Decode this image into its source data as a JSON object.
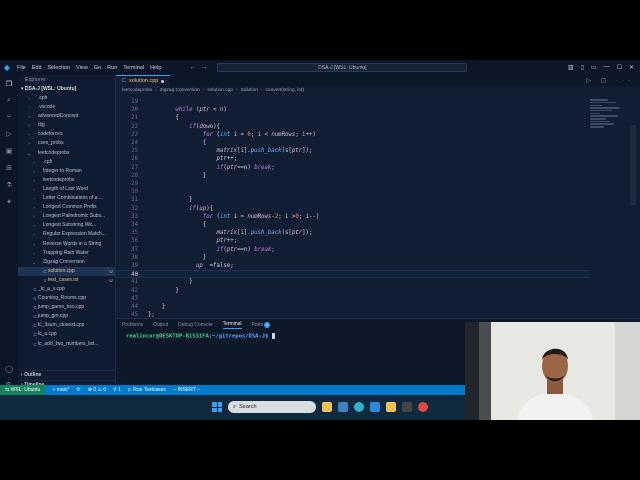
{
  "titlebar": {
    "menu": [
      "File",
      "Edit",
      "Selection",
      "View",
      "Go",
      "Run",
      "Terminal",
      "Help"
    ],
    "command_center": "DSA-J [WSL: Ubuntu]"
  },
  "sidebar": {
    "title": "Explorer",
    "root": "DSA-J [WSL: Ubuntu]",
    "items": [
      {
        "label": ".cph",
        "kind": "folder",
        "depth": 1
      },
      {
        "label": ".vscode",
        "kind": "folder",
        "depth": 1
      },
      {
        "label": "advancedConcept",
        "kind": "folder",
        "depth": 1
      },
      {
        "label": "dig",
        "kind": "folder",
        "depth": 1
      },
      {
        "label": "codeforces",
        "kind": "folder",
        "depth": 1
      },
      {
        "label": "cses_probs",
        "kind": "folder",
        "depth": 1
      },
      {
        "label": "leetcodeprobs",
        "kind": "folder-open",
        "depth": 1
      },
      {
        "label": ".cph",
        "kind": "folder",
        "depth": 2
      },
      {
        "label": "Integer to Roman",
        "kind": "folder",
        "depth": 2
      },
      {
        "label": "leetcodeprobs",
        "kind": "folder",
        "depth": 2
      },
      {
        "label": "Length of Last Word",
        "kind": "folder",
        "depth": 2
      },
      {
        "label": "Letter Combinations of a ...",
        "kind": "folder",
        "depth": 2
      },
      {
        "label": "Longest Common Prefix",
        "kind": "folder",
        "depth": 2
      },
      {
        "label": "Longest Palindromic Subs...",
        "kind": "folder",
        "depth": 2
      },
      {
        "label": "Longest Substring Wit...",
        "kind": "folder",
        "depth": 2
      },
      {
        "label": "Regular Expression Match...",
        "kind": "folder",
        "depth": 2
      },
      {
        "label": "Reverse Words in a String",
        "kind": "folder",
        "depth": 2
      },
      {
        "label": "Trapping Rain Water",
        "kind": "folder",
        "depth": 2
      },
      {
        "label": "Zigzag Conversion",
        "kind": "folder-open",
        "depth": 2
      },
      {
        "label": "solution.cpp",
        "kind": "cpp",
        "depth": 3,
        "badge": "U",
        "active": true
      },
      {
        "label": "test_cases.txt",
        "kind": "txt",
        "depth": 3,
        "badge": "U"
      },
      {
        "label": "_lc_a_s.cpp",
        "kind": "cpp",
        "depth": 1
      },
      {
        "label": "Counting_Rooms.cpp",
        "kind": "cpp",
        "depth": 1
      },
      {
        "label": "jump_game_two.cpp",
        "kind": "cpp",
        "depth": 1
      },
      {
        "label": "jump_gm.cpp",
        "kind": "cpp",
        "depth": 1
      },
      {
        "label": "lc_3sum_closest.cpp",
        "kind": "cpp",
        "depth": 1
      },
      {
        "label": "lc_a.cpp",
        "kind": "cpp",
        "depth": 1
      },
      {
        "label": "lc_add_two_numbers_list...",
        "kind": "cpp",
        "depth": 1
      }
    ],
    "outline": "Outline",
    "timeline": "Timeline"
  },
  "editor": {
    "tab_label": "solution.cpp",
    "breadcrumb": [
      "leetcodeprobs",
      "Zigzag Conversion",
      "solution.cpp",
      "Solution",
      "convert(string, int)"
    ],
    "lines": [
      {
        "n": "19",
        "text": ""
      },
      {
        "n": "20",
        "text": "        while (ptr < n)"
      },
      {
        "n": "21",
        "text": "        {"
      },
      {
        "n": "22",
        "text": "            if(down){"
      },
      {
        "n": "23",
        "text": "                for (int i = 0; i < numRows; i++)"
      },
      {
        "n": "24",
        "text": "                {"
      },
      {
        "n": "25",
        "text": "                    matrix[i].push_back(s[ptr]);"
      },
      {
        "n": "26",
        "text": "                    ptr++;"
      },
      {
        "n": "27",
        "text": "                    if(ptr==n) break;"
      },
      {
        "n": "28",
        "text": "                }"
      },
      {
        "n": "29",
        "text": ""
      },
      {
        "n": "30",
        "text": ""
      },
      {
        "n": "31",
        "text": "            }"
      },
      {
        "n": "32",
        "text": "            if(up){"
      },
      {
        "n": "33",
        "text": "                for (int i = numRows-2; i >0; i--)"
      },
      {
        "n": "34",
        "text": "                {"
      },
      {
        "n": "35",
        "text": "                    matrix[i].push_back(s[ptr]);"
      },
      {
        "n": "36",
        "text": "                    ptr++;"
      },
      {
        "n": "37",
        "text": "                    if(ptr==n) break;"
      },
      {
        "n": "38",
        "text": "                }"
      },
      {
        "n": "39",
        "text": "              up  =false;"
      },
      {
        "n": "40",
        "text": "",
        "current": true
      },
      {
        "n": "41",
        "text": "            }"
      },
      {
        "n": "42",
        "text": "        }"
      },
      {
        "n": "43",
        "text": ""
      },
      {
        "n": "44",
        "text": "    }"
      },
      {
        "n": "45",
        "text": "};"
      }
    ]
  },
  "panel": {
    "tabs": [
      "Problems",
      "Output",
      "Debug Console",
      "Terminal",
      "Ports"
    ],
    "active_tab": "Terminal",
    "ports_count": "1",
    "prompt_user": "realincor@DESKTOP-B1531FA",
    "prompt_path": ":~/gitrepos/DSA-J$"
  },
  "statusbar": {
    "remote": "WSL: Ubuntu",
    "branch": "main*",
    "sync": "⟳",
    "errors": "⊗ 0 ⚠ 0",
    "ports": "⚲ 1",
    "run_testcases": "Run Testcases",
    "mode": "-- INSERT --"
  },
  "taskbar": {
    "search_placeholder": "Search"
  },
  "colors": {
    "accent": "#007acc",
    "editor_bg": "#101d33",
    "keyword": "#c678dd",
    "type": "#4fc1ff",
    "function": "#82aaff",
    "terminal_user": "#4fd08a",
    "terminal_path": "#5aa6ff"
  }
}
